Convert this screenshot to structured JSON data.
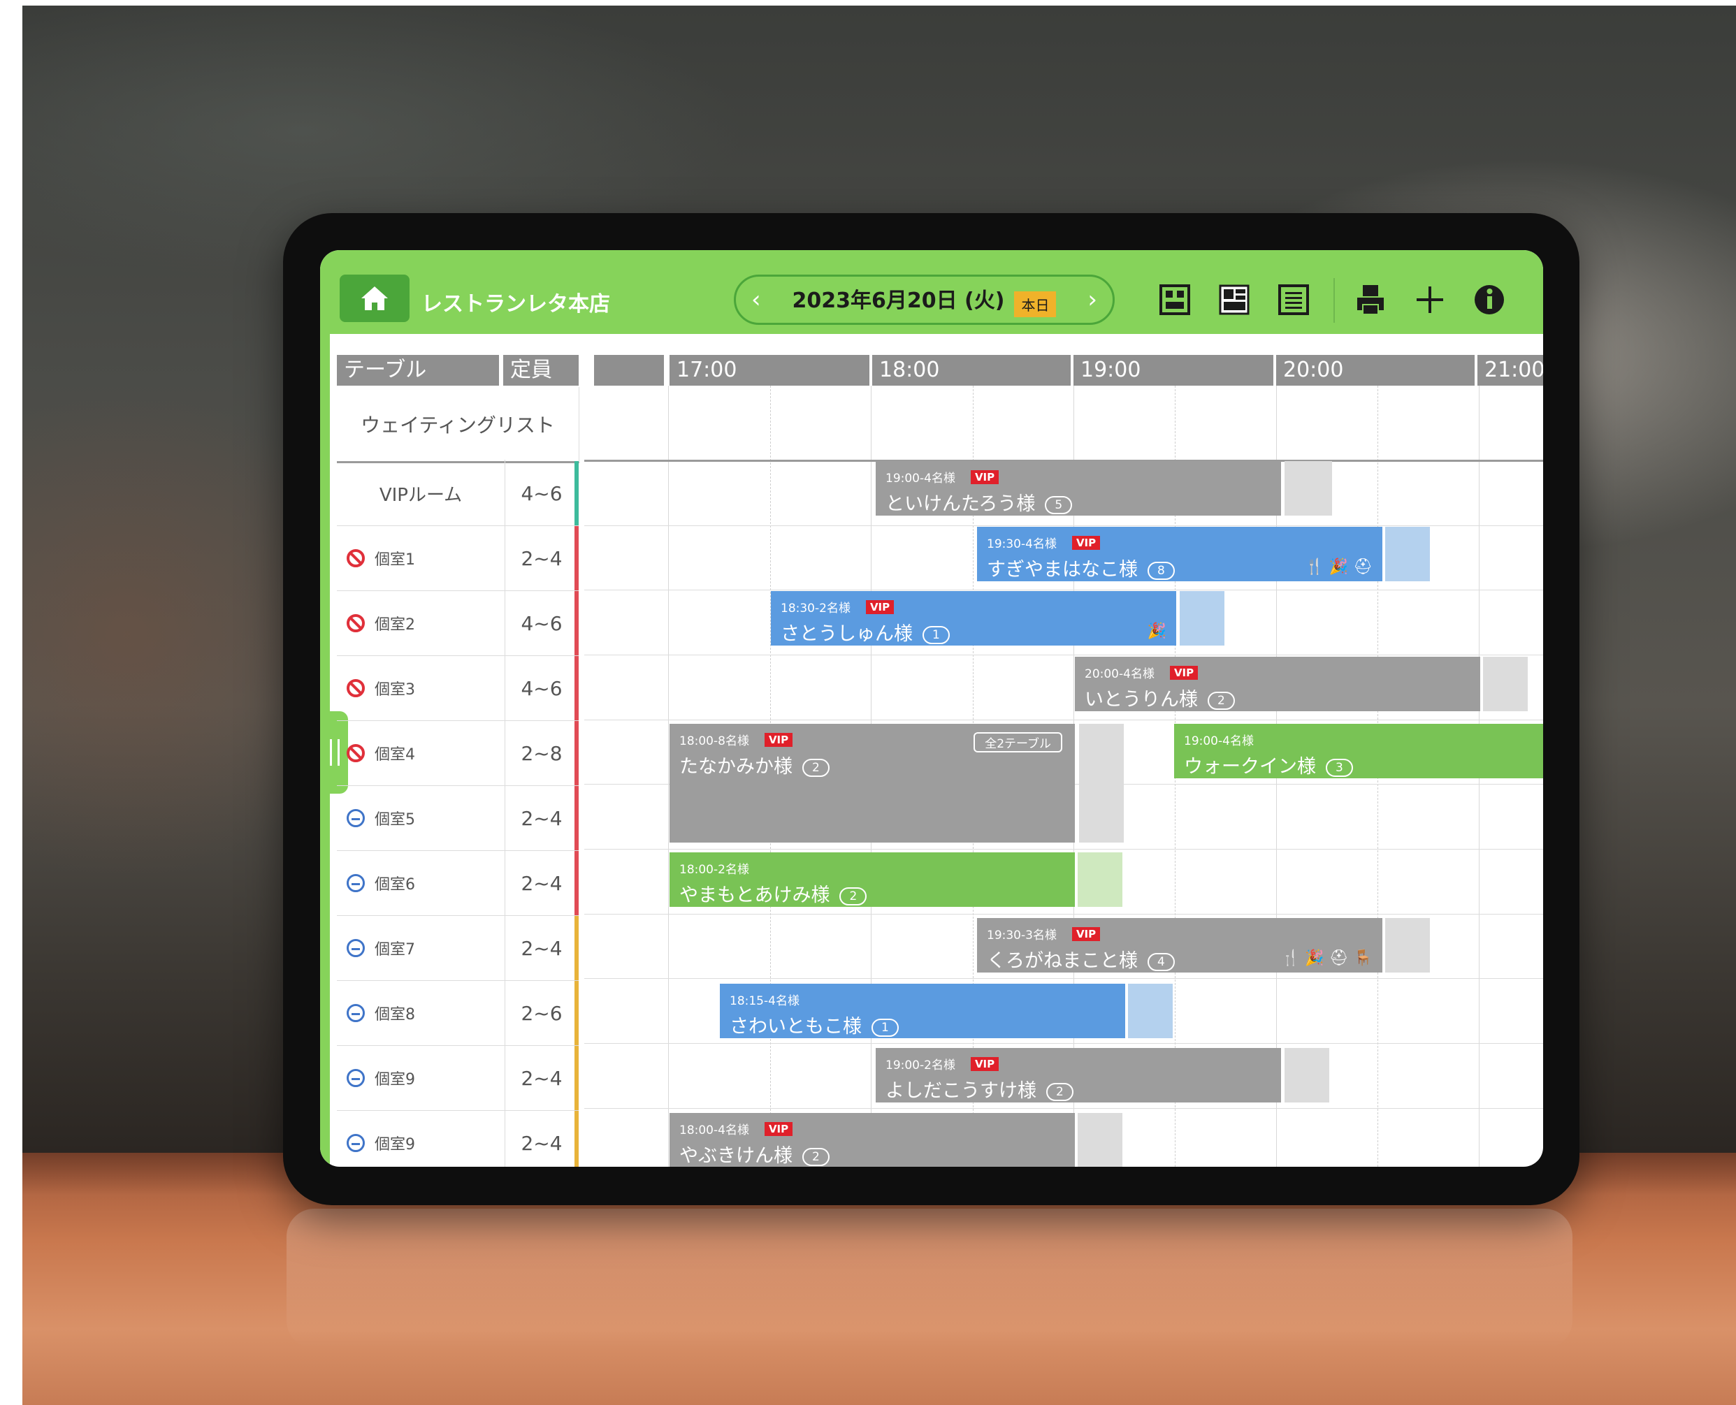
{
  "header": {
    "store_name": "レストランレタ本店",
    "date": "2023年6月20日 (火)",
    "today_badge": "本日",
    "prev_icon": "chevron-left-icon",
    "next_icon": "chevron-right-icon"
  },
  "toolbar": {
    "icons": [
      "floor-map-icon",
      "layout-icon",
      "list-view-icon",
      "print-icon",
      "add-icon",
      "info-icon"
    ]
  },
  "columns": {
    "table": "テーブル",
    "capacity": "定員",
    "times": [
      "17:00",
      "18:00",
      "19:00",
      "20:00",
      "21:00"
    ]
  },
  "waiting_list": "ウェイティングリスト",
  "tables": [
    {
      "name": "VIPルーム",
      "capacity": "4~6",
      "status": "none",
      "bar": "#3dbb9c"
    },
    {
      "name": "個室1",
      "capacity": "2~4",
      "status": "ng",
      "bar": "#e14b55"
    },
    {
      "name": "個室2",
      "capacity": "4~6",
      "status": "ng",
      "bar": "#e14b55"
    },
    {
      "name": "個室3",
      "capacity": "4~6",
      "status": "ng",
      "bar": "#e14b55"
    },
    {
      "name": "個室4",
      "capacity": "2~8",
      "status": "ng",
      "bar": "#e14b55"
    },
    {
      "name": "個室5",
      "capacity": "2~4",
      "status": "ok",
      "bar": "#e14b55"
    },
    {
      "name": "個室6",
      "capacity": "2~4",
      "status": "ok",
      "bar": "#e14b55"
    },
    {
      "name": "個室7",
      "capacity": "2~4",
      "status": "ok",
      "bar": "#e8b33a"
    },
    {
      "name": "個室8",
      "capacity": "2~6",
      "status": "ok",
      "bar": "#e8b33a"
    },
    {
      "name": "個室9",
      "capacity": "2~4",
      "status": "ok",
      "bar": "#e8b33a"
    },
    {
      "name": "個室9",
      "capacity": "2~4",
      "status": "ok",
      "bar": "#e8b33a"
    }
  ],
  "reservations": [
    {
      "meta": "19:00-4名様",
      "vip": "VIP",
      "name": "といけんたろう様",
      "count": "5",
      "color": "gray",
      "icons": ""
    },
    {
      "meta": "19:30-4名様",
      "vip": "VIP",
      "name": "すぎやまはなこ様",
      "count": "8",
      "color": "blue",
      "icons": "🍴 🎉 ⛑"
    },
    {
      "meta": "18:30-2名様",
      "vip": "VIP",
      "name": "さとうしゅん様",
      "count": "1",
      "color": "blue",
      "icons": "🎉"
    },
    {
      "meta": "20:00-4名様",
      "vip": "VIP",
      "name": "いとうりん様",
      "count": "2",
      "color": "gray",
      "icons": ""
    },
    {
      "meta": "18:00-8名様",
      "vip": "VIP",
      "name": "たなかみか様",
      "count": "2",
      "color": "gray",
      "icons": "",
      "all_tables": "全2テーブル"
    },
    {
      "meta": "19:00-4名様",
      "vip": "",
      "name": "ウォークイン様",
      "count": "3",
      "color": "green",
      "icons": ""
    },
    {
      "meta": "18:00-2名様",
      "vip": "",
      "name": "やまもとあけみ様",
      "count": "2",
      "color": "green",
      "icons": ""
    },
    {
      "meta": "19:30-3名様",
      "vip": "VIP",
      "name": "くろがねまこと様",
      "count": "4",
      "color": "gray",
      "icons": "🍴 🎉 ⛑ 🪑"
    },
    {
      "meta": "18:15-4名様",
      "vip": "",
      "name": "さわいともこ様",
      "count": "1",
      "color": "blue",
      "icons": ""
    },
    {
      "meta": "19:00-2名様",
      "vip": "VIP",
      "name": "よしだこうすけ様",
      "count": "2",
      "color": "gray",
      "icons": ""
    },
    {
      "meta": "18:00-4名様",
      "vip": "VIP",
      "name": "やぶきけん様",
      "count": "2",
      "color": "gray",
      "icons": ""
    }
  ]
}
